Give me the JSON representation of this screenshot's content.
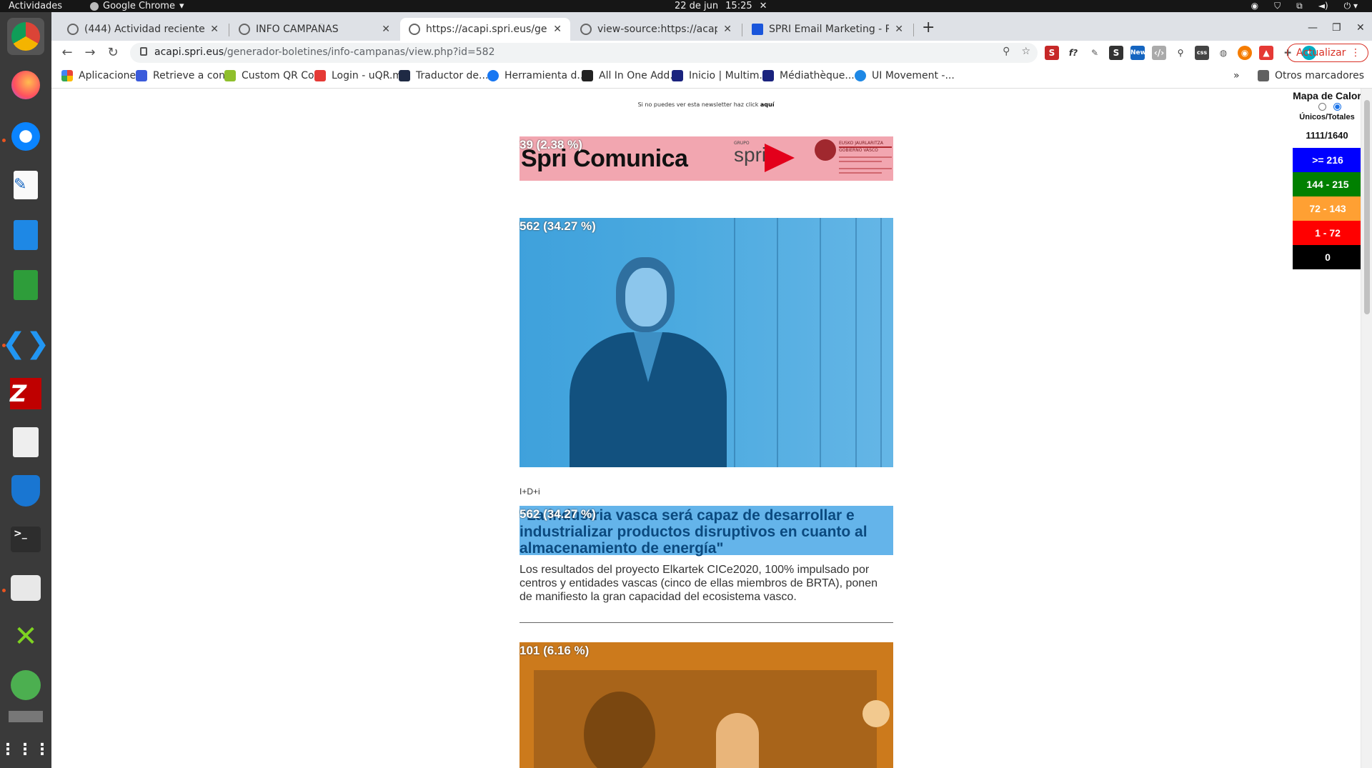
{
  "topbar": {
    "activities": "Actividades",
    "app_name": "Google Chrome",
    "date": "22 de jun",
    "time": "15:25"
  },
  "tabs": [
    {
      "title": "(444) Actividad reciente | ",
      "active": false
    },
    {
      "title": "INFO CAMPAÑAS",
      "active": false
    },
    {
      "title": "https://acapi.spri.eus/gen",
      "active": true
    },
    {
      "title": "view-source:https://acapi",
      "active": false
    },
    {
      "title": "SPRI Email Marketing - Re",
      "active": false
    }
  ],
  "toolbar": {
    "url_host": "acapi.spri.eus",
    "url_path": "/generador-boletines/info-campanas/view.php?id=582",
    "update_label": "Actualizar"
  },
  "bookmarks": [
    {
      "label": "Aplicaciones",
      "color": "#e94235"
    },
    {
      "label": "Retrieve a con...",
      "color": "#3b5bdb"
    },
    {
      "label": "Custom QR Co...",
      "color": "#8fbf2c"
    },
    {
      "label": "Login - uQR.me",
      "color": "#e53935"
    },
    {
      "label": "Traductor de...",
      "color": "#1f2a44"
    },
    {
      "label": "Herramienta d...",
      "color": "#1877f2"
    },
    {
      "label": "All In One Add...",
      "color": "#222222"
    },
    {
      "label": "Inicio | Multim...",
      "color": "#1a237e"
    },
    {
      "label": "Médiathèque...",
      "color": "#1a237e"
    },
    {
      "label": "UI Movement -...",
      "color": "#1e88e5"
    }
  ],
  "bookmarks_overflow": "»",
  "other_bookmarks": "Otros marcadores",
  "newsletter": {
    "notice_text": "Si no puedes ver esta newsletter haz click ",
    "notice_link": "aquí",
    "banner_stat": "39 (2.38 %)",
    "banner_brand": "Spri Comunica",
    "banner_group": "GRUPO",
    "banner_spri": "spri",
    "banner_gov_line1": "EUSKO JAURLARITZA",
    "banner_gov_line2": "GOBIERNO VASCO",
    "photo1_stat": "562 (34.27 %)",
    "category": "I+D+i",
    "headline_stat": "562 (34.27 %)",
    "headline": "\"La industria vasca será capaz de desarrollar e industrializar productos disruptivos en cuanto al almacenamiento de energía\"",
    "summary": "Los resultados del proyecto Elkartek CICe2020, 100% impulsado por centros y entidades vascas (cinco de ellas miembros de BRTA), ponen de manifiesto la gran capacidad del ecosistema vasco.",
    "photo2_stat": "101 (6.16 %)"
  },
  "heatmap": {
    "title": "Mapa de Calor",
    "subtitle": "Únicos/Totales",
    "count": "1111/1640",
    "legend": [
      {
        "label": ">= 216",
        "color": "#0000ff"
      },
      {
        "label": "144 - 215",
        "color": "#008000"
      },
      {
        "label": "72 - 143",
        "color": "#ffa033"
      },
      {
        "label": "1 - 72",
        "color": "#ff0000"
      },
      {
        "label": "0",
        "color": "#000000"
      }
    ]
  }
}
